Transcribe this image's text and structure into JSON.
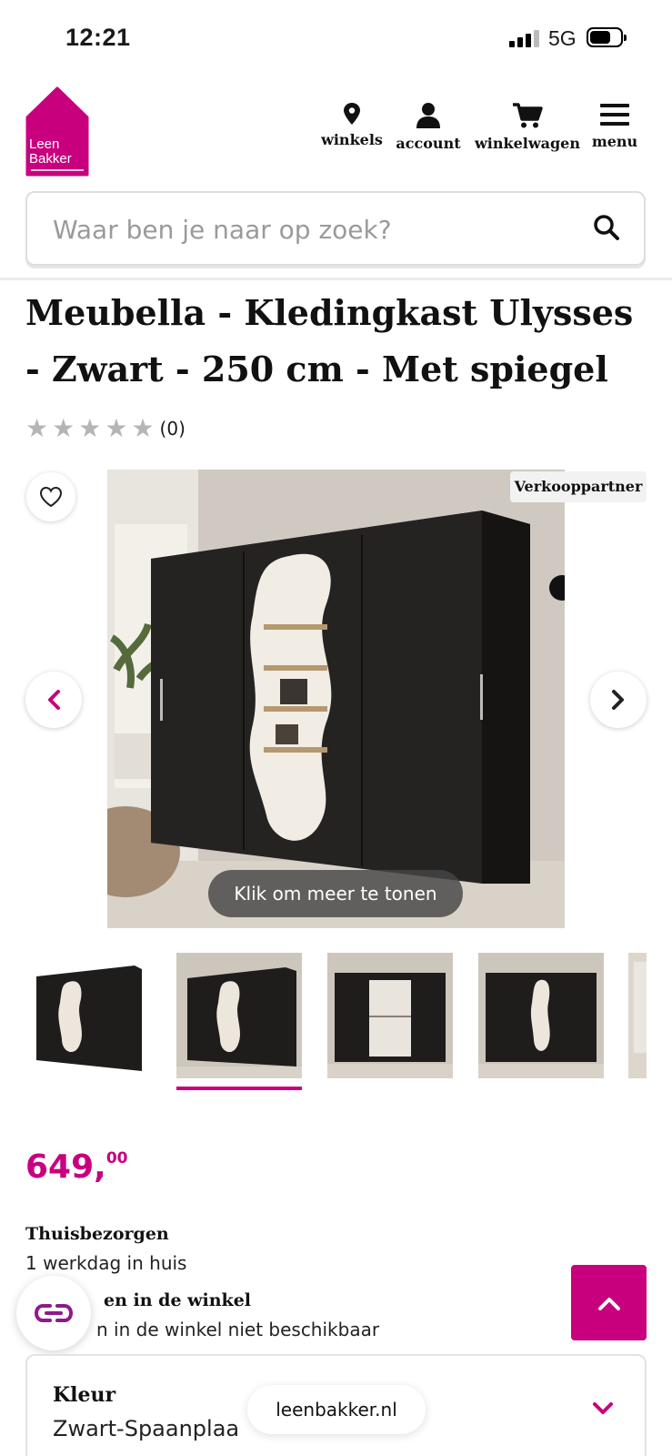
{
  "status_bar": {
    "time": "12:21",
    "network": "5G"
  },
  "brand": {
    "logo_line1": "Leen",
    "logo_line2": "Bakker",
    "accent_color": "#c8007e"
  },
  "nav": {
    "stores": {
      "label": "winkels",
      "icon": "map-pin-icon"
    },
    "account": {
      "label": "account",
      "icon": "user-icon"
    },
    "cart": {
      "label": "winkelwagen",
      "icon": "shopping-cart-icon"
    },
    "menu": {
      "label": "menu",
      "icon": "hamburger-menu-icon"
    }
  },
  "search": {
    "placeholder": "Waar ben je naar op zoek?",
    "icon": "search-icon"
  },
  "product": {
    "title": "Meubella - Kledingkast Ulysses - Zwart - 250 cm - Met spiegel",
    "rating_stars": 0,
    "rating_max": 5,
    "review_count": "(0)",
    "partner_badge": "Verkooppartner",
    "show_more_label": "Klik om meer te tonen",
    "thumbnail_count_visible": 5,
    "selected_thumbnail": 2,
    "price_int": "649,",
    "price_dec": "00"
  },
  "delivery": {
    "home_title": "Thuisbezorgen",
    "home_text": "1 werkdag in huis",
    "store_title": "en in de winkel",
    "store_text": "n in de winkel niet beschikbaar"
  },
  "variant": {
    "label": "Kleur",
    "value": "Zwart-Spaanplaa"
  },
  "browser": {
    "url": "leenbakker.nl"
  }
}
